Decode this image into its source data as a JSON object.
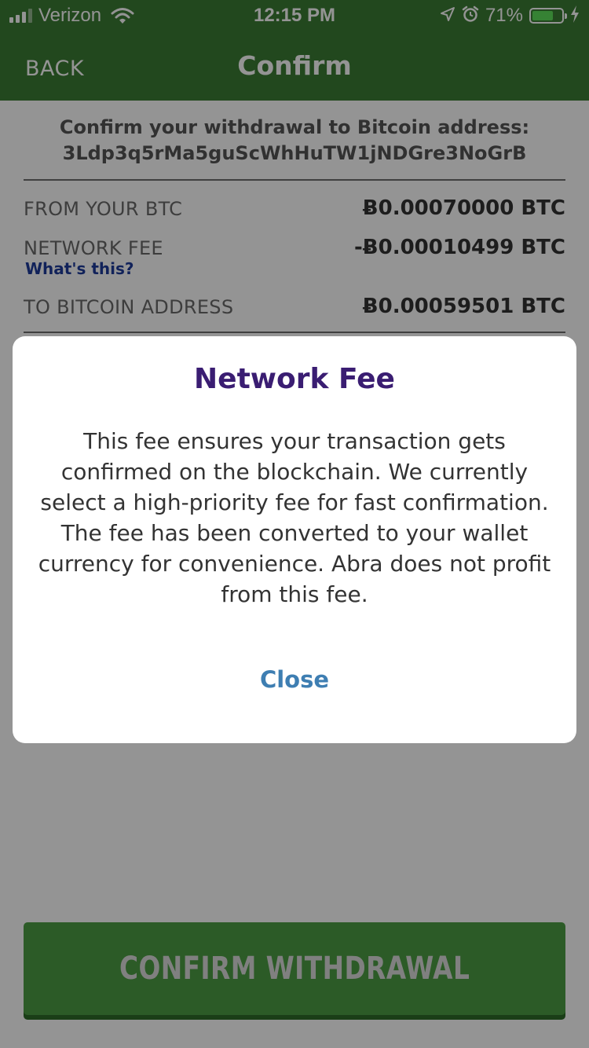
{
  "status_bar": {
    "carrier": "Verizon",
    "time": "12:15 PM",
    "battery_percent": "71%",
    "battery_level": 0.71,
    "signal_bars": 3,
    "icons": [
      "signal-icon",
      "wifi-icon",
      "location-icon",
      "alarm-icon",
      "battery-icon",
      "charging-icon"
    ]
  },
  "nav": {
    "back_label": "BACK",
    "title": "Confirm"
  },
  "withdrawal": {
    "intro_line1": "Confirm your withdrawal to Bitcoin address:",
    "address": "3Ldp3q5rMa5guScWhHuTW1jNDGre3NoGrB",
    "rows": [
      {
        "label": "FROM YOUR BTC",
        "value": "Ƀ0.00070000 BTC"
      },
      {
        "label": "NETWORK FEE",
        "value": "-Ƀ0.00010499 BTC",
        "link": "What's this?"
      },
      {
        "label": "TO BITCOIN ADDRESS",
        "value": "Ƀ0.00059501 BTC"
      }
    ],
    "confirm_button": "CONFIRM WITHDRAWAL"
  },
  "modal": {
    "title": "Network Fee",
    "body": "This fee ensures your transaction gets confirmed on the blockchain. We currently select a high-priority fee for fast confirmation. The fee has been converted to your wallet currency for convenience. Abra does not profit from this fee.",
    "close_label": "Close"
  },
  "colors": {
    "brand_green": "#3c7d35",
    "button_green": "#4c9e44",
    "modal_title": "#3a1d72",
    "link_blue": "#1e3c9c",
    "close_blue": "#3e7eb2"
  }
}
